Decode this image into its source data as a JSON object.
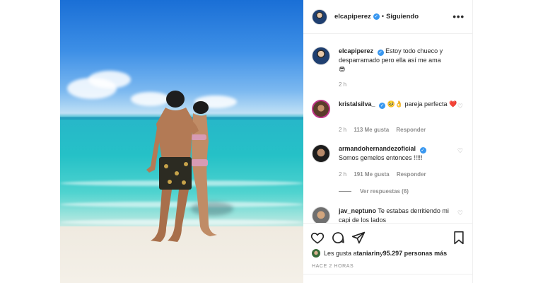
{
  "post": {
    "author": "elcapiperez",
    "follow_status": "Siguiendo",
    "more_glyph": "•••",
    "caption_text": "Estoy todo chueco y desparramado pero ella así me ama",
    "caption_emoji": "😎",
    "caption_time": "2 h",
    "likes_prefix": "Les gusta a ",
    "likes_user": "taniarin",
    "likes_middle": " y ",
    "likes_count": "95.297 personas más",
    "timestamp": "HACE 2 HORAS"
  },
  "comments": [
    {
      "author": "kristalsilva_",
      "text": "🥺👌 pareja perfecta ❤️",
      "time": "2 h",
      "likes": "113 Me gusta",
      "reply": "Responder"
    },
    {
      "author": "armandohernandezoficial",
      "text": "Somos gemelos entonces !!!!!",
      "time": "2 h",
      "likes": "191 Me gusta",
      "reply": "Responder",
      "view_replies": "Ver respuestas (6)"
    },
    {
      "author": "jav_neptuno",
      "text": "Te estabas derritiendo mi capi de los lados"
    }
  ],
  "icons": {
    "heart": "heart-icon",
    "comment": "comment-icon",
    "share": "share-icon",
    "save": "bookmark-icon",
    "verified": "verified-icon"
  },
  "colors": {
    "verified": "#3897f0",
    "text": "#262626",
    "muted": "#8e8e8e",
    "border": "#efefef"
  }
}
